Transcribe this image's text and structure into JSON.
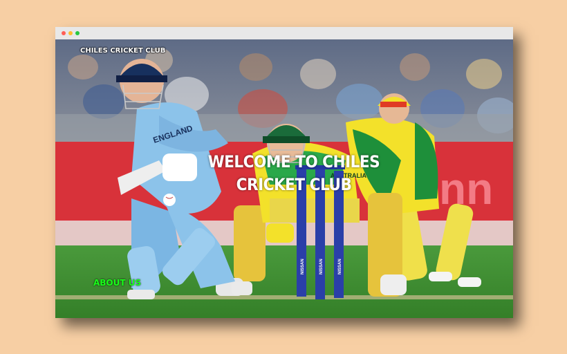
{
  "site": {
    "brand": "CHILES CRICKET CLUB",
    "headline": "WELCOME TO CHILES CRICKET CLUB",
    "nav_about": "ABOUT US"
  },
  "hero_photo": {
    "batsman_shirt_text": "ENGLAND",
    "keeper_shirt_text": "AUSTRALIA",
    "stump_text": "NISSAN",
    "banner_text": "nn"
  },
  "colors": {
    "page_background": "#f7cfa4",
    "titlebar": "#e8e8e8",
    "nav_link": "#19ff19",
    "england_blue": "#8cc3ea",
    "australia_green": "#1e8f3a",
    "australia_gold": "#f3e12a"
  }
}
